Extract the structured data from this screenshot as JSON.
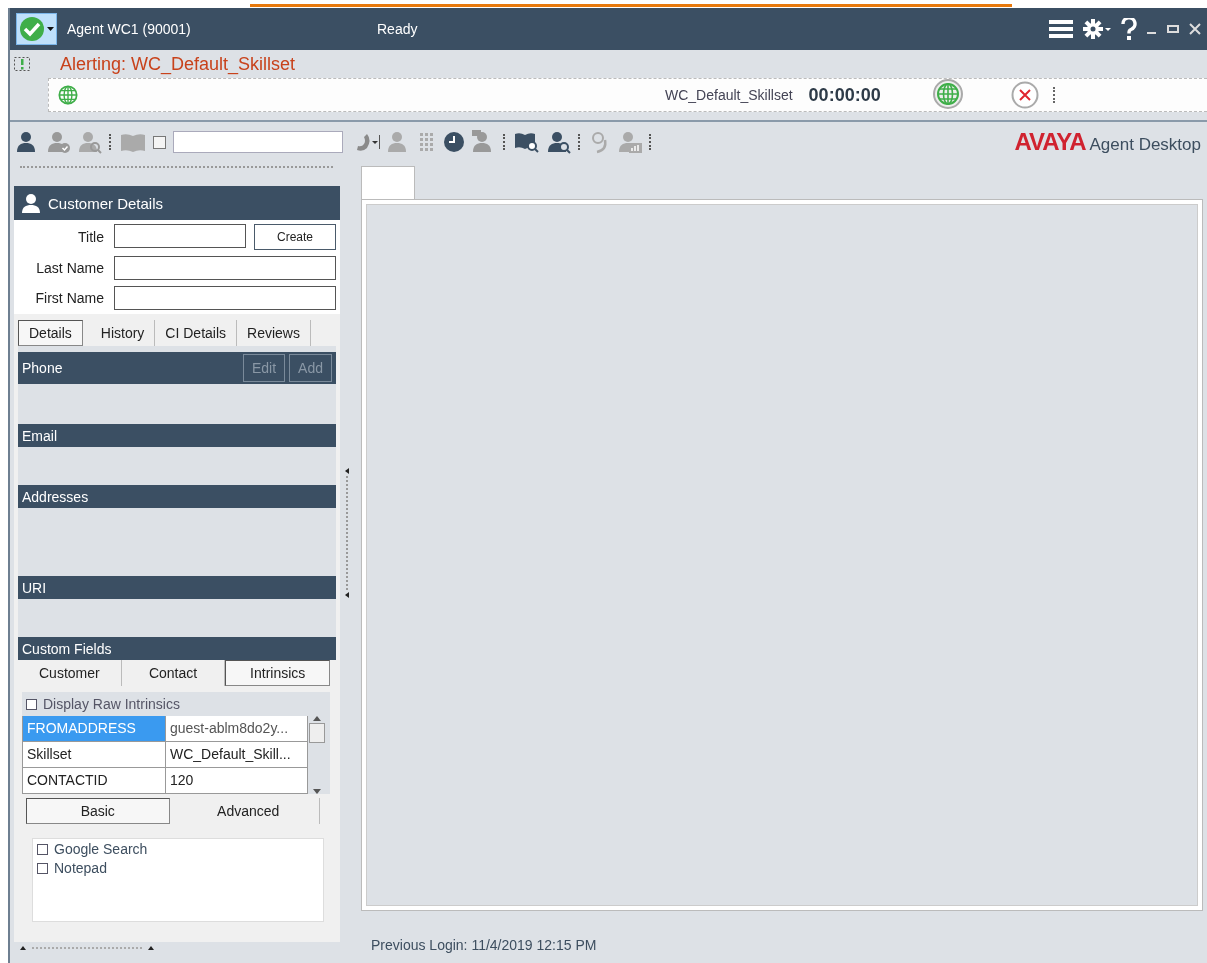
{
  "header": {
    "agent": "Agent WC1 (90001)",
    "state": "Ready"
  },
  "alert": {
    "text": "Alerting: WC_Default_Skillset"
  },
  "call_bar": {
    "skillset": "WC_Default_Skillset",
    "timer": "00:00:00"
  },
  "toolbar": {
    "dial_checkbox": {
      "checked": false
    }
  },
  "branding": {
    "logo": "AVAYA",
    "product": "Agent Desktop"
  },
  "customer_details": {
    "title": "Customer Details",
    "create_button": "Create",
    "fields": [
      {
        "label": "Title"
      },
      {
        "label": "Last Name"
      },
      {
        "label": "First Name"
      }
    ]
  },
  "detail_tabs": [
    {
      "label": "Details",
      "selected": true
    },
    {
      "label": "History",
      "selected": false
    },
    {
      "label": "CI Details",
      "selected": false
    },
    {
      "label": "Reviews",
      "selected": false
    }
  ],
  "sections": [
    {
      "title": "Phone",
      "buttons": [
        {
          "label": "Edit",
          "disabled": true
        },
        {
          "label": "Add",
          "disabled": true
        }
      ]
    },
    {
      "title": "Email"
    },
    {
      "title": "Addresses"
    },
    {
      "title": "URI"
    },
    {
      "title": "Custom Fields"
    }
  ],
  "custom_tabs": [
    {
      "label": "Customer",
      "selected": false
    },
    {
      "label": "Contact",
      "selected": false
    },
    {
      "label": "Intrinsics",
      "selected": true
    }
  ],
  "raw_intrinsics": {
    "label": "Display Raw Intrinsics",
    "checked": false
  },
  "intrinsics": [
    {
      "key": "FROMADDRESS",
      "value": "guest-ablm8do2y...",
      "selected": true
    },
    {
      "key": "Skillset",
      "value": "WC_Default_Skill...",
      "selected": false
    },
    {
      "key": "CONTACTID",
      "value": "120",
      "selected": false
    }
  ],
  "mode_tabs": [
    {
      "label": "Basic",
      "selected": true
    },
    {
      "label": "Advanced",
      "selected": false
    }
  ],
  "tools": [
    {
      "label": "Google Search",
      "checked": false
    },
    {
      "label": "Notepad",
      "checked": false
    }
  ],
  "status": "Previous Login: 11/4/2019 12:15 PM"
}
